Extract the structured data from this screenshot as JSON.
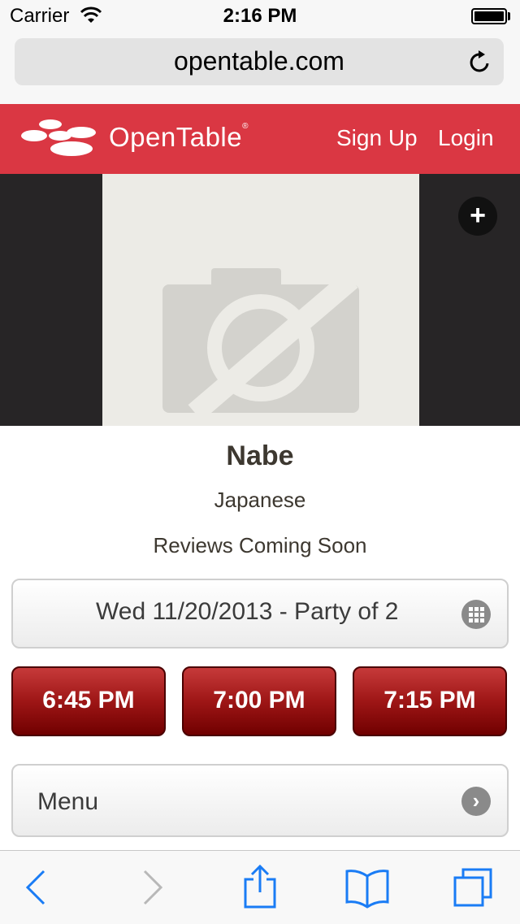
{
  "status_bar": {
    "carrier": "Carrier",
    "time": "2:16 PM"
  },
  "browser": {
    "url": "opentable.com"
  },
  "header": {
    "logo_text": "OpenTable",
    "logo_reg": "®",
    "signup": "Sign Up",
    "login": "Login"
  },
  "restaurant": {
    "name": "Nabe",
    "cuisine": "Japanese",
    "reviews": "Reviews Coming Soon"
  },
  "reservation": {
    "summary": "Wed 11/20/2013 - Party of 2"
  },
  "time_slots": [
    "6:45 PM",
    "7:00 PM",
    "7:15 PM"
  ],
  "menu": {
    "label": "Menu"
  },
  "colors": {
    "brand_red": "#da3743",
    "slot_red": "#9e1616",
    "ios_blue": "#1a7cf5"
  },
  "icons": {
    "wifi": "wifi-icon",
    "battery": "battery-icon",
    "reload": "reload-icon",
    "add": "plus-icon",
    "calendar": "calendar-grid-icon",
    "chevron": "chevron-right-icon",
    "back": "back-arrow-icon",
    "forward": "forward-arrow-icon",
    "share": "share-icon",
    "bookmarks": "bookmarks-icon",
    "tabs": "tabs-icon"
  }
}
